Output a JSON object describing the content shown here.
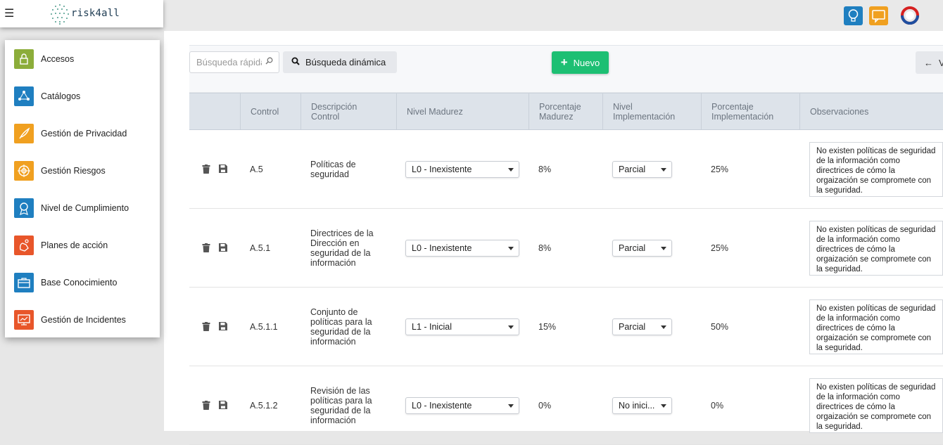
{
  "app": {
    "logo_text": "risk4all"
  },
  "colors": {
    "accent_green": "#1dbf73",
    "header_bg": "#dde3ea"
  },
  "sidebar": {
    "items": [
      {
        "label": "Accesos",
        "icon": "lock-icon",
        "color": "#8cad3a"
      },
      {
        "label": "Catálogos",
        "icon": "network-icon",
        "color": "#1f7fc0"
      },
      {
        "label": "Gestión de Privacidad",
        "icon": "feather-icon",
        "color": "#f0a020"
      },
      {
        "label": "Gestión Riesgos",
        "icon": "target-icon",
        "color": "#f0a020"
      },
      {
        "label": "Nivel de Cumplimiento",
        "icon": "badge-icon",
        "color": "#1f7fc0"
      },
      {
        "label": "Planes de acción",
        "icon": "hand-icon",
        "color": "#e8562a"
      },
      {
        "label": "Base Conocimiento",
        "icon": "briefcase-icon",
        "color": "#1f7fc0"
      },
      {
        "label": "Gestión de Incidentes",
        "icon": "monitor-icon",
        "color": "#e8562a"
      }
    ]
  },
  "toolbar": {
    "search_placeholder": "Búsqueda rápida",
    "dynamic_search_label": "Búsqueda dinámica",
    "new_label": "Nuevo",
    "back_label": "V"
  },
  "table": {
    "headers": {
      "control": "Control",
      "descripcion": "Descripción Control",
      "nivel_madurez": "Nivel Madurez",
      "porcentaje_madurez": "Porcentaje Madurez",
      "nivel_implementacion": "Nivel Implementación",
      "porcentaje_implementacion": "Porcentaje Implementación",
      "observaciones": "Observaciones"
    },
    "rows": [
      {
        "control": "A.5",
        "descripcion": "Políticas de seguridad",
        "nivel_madurez": "L0 - Inexistente",
        "porcentaje_madurez": "8%",
        "nivel_implementacion": "Parcial",
        "porcentaje_implementacion": "25%",
        "observaciones": "No existen políticas de seguridad de la información como directrices de cómo la orgaización se compromete con la seguridad."
      },
      {
        "control": "A.5.1",
        "descripcion": "Directrices de la Dirección en seguridad de la información",
        "nivel_madurez": "L0 - Inexistente",
        "porcentaje_madurez": "8%",
        "nivel_implementacion": "Parcial",
        "porcentaje_implementacion": "25%",
        "observaciones": "No existen políticas de seguridad de la información como directrices de cómo la orgaización se compromete con la seguridad."
      },
      {
        "control": "A.5.1.1",
        "descripcion": "Conjunto de políticas para la seguridad de la información",
        "nivel_madurez": "L1 - Inicial",
        "porcentaje_madurez": "15%",
        "nivel_implementacion": "Parcial",
        "porcentaje_implementacion": "50%",
        "observaciones": "No existen políticas de seguridad de la información como directrices de cómo la orgaización se compromete con la seguridad."
      },
      {
        "control": "A.5.1.2",
        "descripcion": "Revisión de las políticas para la seguridad de la información",
        "nivel_madurez": "L0 - Inexistente",
        "porcentaje_madurez": "0%",
        "nivel_implementacion": "No inici...",
        "porcentaje_implementacion": "0%",
        "observaciones": "No existen políticas de seguridad de la información como directrices de cómo la orgaización se compromete con la seguridad."
      }
    ]
  }
}
